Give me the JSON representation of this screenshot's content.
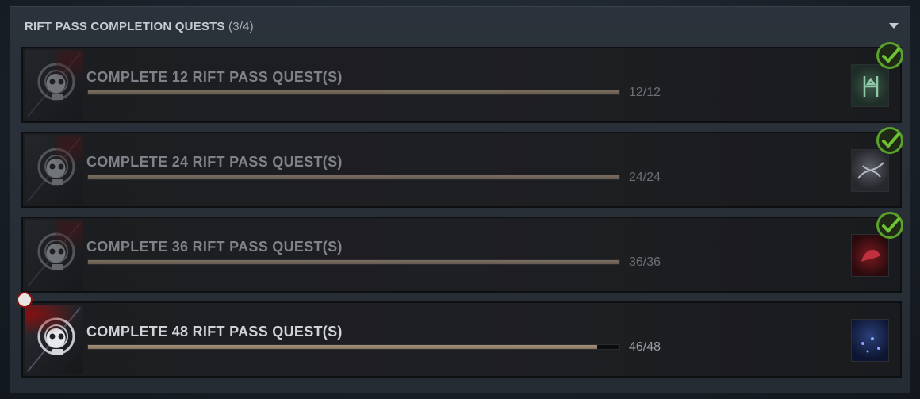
{
  "header": {
    "title": "RIFT PASS COMPLETION QUESTS",
    "count": "(3/4)"
  },
  "colors": {
    "accent_check": "#5aa02c",
    "progress_fill": "#a38f78",
    "blood": "#8a1010"
  },
  "quests": [
    {
      "title": "COMPLETE 12 RIFT PASS QUEST(S)",
      "progress_text": "12/12",
      "progress": 1.0,
      "completed": true,
      "reward_icon": "rune-glyph-reward-icon"
    },
    {
      "title": "COMPLETE 24 RIFT PASS QUEST(S)",
      "progress_text": "24/24",
      "progress": 1.0,
      "completed": true,
      "reward_icon": "bone-spirit-reward-icon"
    },
    {
      "title": "COMPLETE 36 RIFT PASS QUEST(S)",
      "progress_text": "36/36",
      "progress": 1.0,
      "completed": true,
      "reward_icon": "red-beast-reward-icon"
    },
    {
      "title": "COMPLETE 48 RIFT PASS QUEST(S)",
      "progress_text": "46/48",
      "progress": 0.958,
      "completed": false,
      "reward_icon": "blue-night-reward-icon"
    }
  ]
}
